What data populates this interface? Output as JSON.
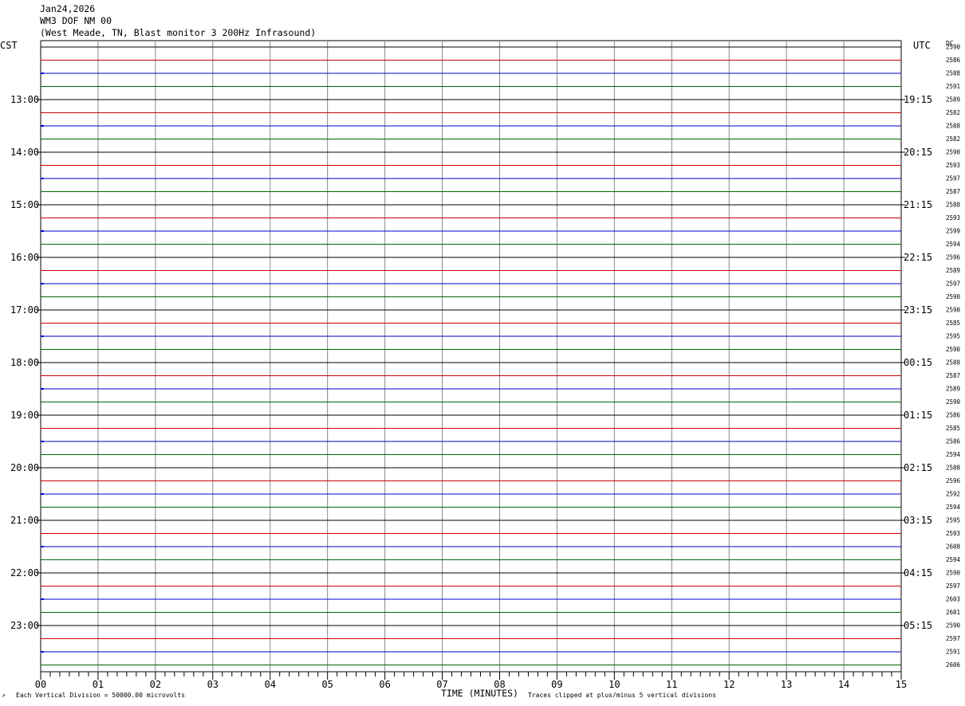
{
  "header": {
    "date": "Jan24,2026",
    "station": "WM3 DOF NM 00",
    "description": "(West Meade, TN, Blast monitor 3 200Hz Infrasound)"
  },
  "left_axis_title": "CST",
  "right_axis_title": "UTC",
  "dc_title": "DC",
  "footer": {
    "scale_note": "Each Vertical Division = 50000.00 microvolts",
    "x_title": "TIME (MINUTES)",
    "clip_note": "Traces clipped at plus/minus 5 vertical divisions"
  },
  "colors": {
    "trace_cycle": [
      "#000000",
      "#cc0000",
      "#0000cc",
      "#006600"
    ],
    "minute_grid": "#888888"
  },
  "chart_data": {
    "type": "line",
    "title": "WM3 DOF NM 00",
    "xlabel": "TIME (MINUTES)",
    "xlim": [
      0,
      15
    ],
    "x_ticks": [
      "00",
      "01",
      "02",
      "03",
      "04",
      "05",
      "06",
      "07",
      "08",
      "09",
      "10",
      "11",
      "12",
      "13",
      "14",
      "15"
    ],
    "cst_hour_labels": [
      "13:00",
      "14:00",
      "15:00",
      "16:00",
      "17:00",
      "18:00",
      "19:00",
      "20:00",
      "21:00",
      "22:00",
      "23:00"
    ],
    "utc_hour_labels": [
      "19:15",
      "20:15",
      "21:15",
      "22:15",
      "23:15",
      "00:15",
      "01:15",
      "02:15",
      "03:15",
      "04:15",
      "05:15"
    ],
    "trace_minutes": 15,
    "trace_count": 48,
    "dc_offsets": [
      2590,
      2586,
      2588,
      2591,
      2589,
      2582,
      2588,
      2582,
      2590,
      2593,
      2597,
      2587,
      2588,
      2593,
      2599,
      2594,
      2596,
      2589,
      2597,
      2590,
      2590,
      2585,
      2595,
      2590,
      2588,
      2587,
      2589,
      2590,
      2586,
      2585,
      2586,
      2594,
      2588,
      2596,
      2592,
      2594,
      2595,
      2593,
      2608,
      2594,
      2590,
      2597,
      2603,
      2601,
      2590,
      2597,
      2591,
      2606
    ],
    "series_note": "flat traces"
  }
}
